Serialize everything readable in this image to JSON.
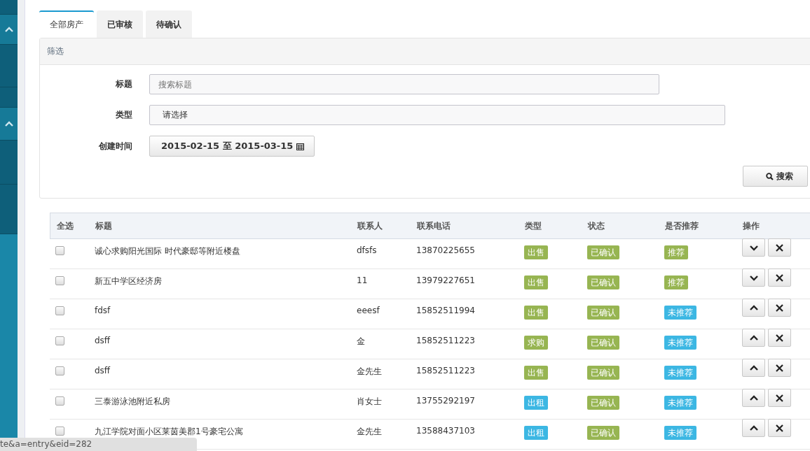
{
  "tabs": [
    {
      "label": "全部房产",
      "selected": true
    },
    {
      "label": "已审核",
      "selected": false
    },
    {
      "label": "待确认",
      "selected": false
    }
  ],
  "filter": {
    "title": "筛选",
    "fields": [
      {
        "kind": "text",
        "label": "标题",
        "placeholder": "搜索标题"
      },
      {
        "kind": "select",
        "label": "类型",
        "value": "请选择"
      },
      {
        "kind": "date",
        "label": "创建时间",
        "value": "2015-02-15 至 2015-03-15"
      }
    ],
    "search_button": "搜索"
  },
  "table": {
    "columns": [
      "全选",
      "标题",
      "联系人",
      "联系电话",
      "类型",
      "状态",
      "是否推荐",
      "操作"
    ],
    "rows": [
      {
        "checked": false,
        "title": "诚心求购阳光国际 时代豪邸等附近楼盘",
        "contact": "dfsfs",
        "phone": "13870225655",
        "type": {
          "label": "出售",
          "color": "#97b552"
        },
        "status": {
          "label": "已确认",
          "color": "#97b552"
        },
        "recommend": {
          "label": "推荐",
          "color": "#97b552"
        },
        "arrow_up": false
      },
      {
        "checked": false,
        "title": "新五中学区经济房",
        "contact": "11",
        "phone": "13979227651",
        "type": {
          "label": "出售",
          "color": "#97b552"
        },
        "status": {
          "label": "已确认",
          "color": "#97b552"
        },
        "recommend": {
          "label": "推荐",
          "color": "#97b552"
        },
        "arrow_up": false
      },
      {
        "checked": false,
        "title": "fdsf",
        "contact": "eeesf",
        "phone": "15852511994",
        "type": {
          "label": "出售",
          "color": "#97b552"
        },
        "status": {
          "label": "已确认",
          "color": "#97b552"
        },
        "recommend": {
          "label": "未推荐",
          "color": "#3cb7e3"
        },
        "arrow_up": true
      },
      {
        "checked": false,
        "title": "dsff",
        "contact": "金",
        "phone": "15852511223",
        "type": {
          "label": "求购",
          "color": "#97b552"
        },
        "status": {
          "label": "已确认",
          "color": "#97b552"
        },
        "recommend": {
          "label": "未推荐",
          "color": "#3cb7e3"
        },
        "arrow_up": true
      },
      {
        "checked": false,
        "title": "dsff",
        "contact": "金先生",
        "phone": "15852511223",
        "type": {
          "label": "出售",
          "color": "#97b552"
        },
        "status": {
          "label": "已确认",
          "color": "#97b552"
        },
        "recommend": {
          "label": "未推荐",
          "color": "#3cb7e3"
        },
        "arrow_up": true
      },
      {
        "checked": false,
        "title": "三泰游泳池附近私房",
        "contact": "肖女士",
        "phone": "13755292197",
        "type": {
          "label": "出租",
          "color": "#3cb7e3"
        },
        "status": {
          "label": "已确认",
          "color": "#97b552"
        },
        "recommend": {
          "label": "未推荐",
          "color": "#3cb7e3"
        },
        "arrow_up": true
      },
      {
        "checked": false,
        "title": "九江学院对面小区莱茵美郡1号豪宅公寓",
        "contact": "金先生",
        "phone": "13588437103",
        "type": {
          "label": "出租",
          "color": "#3cb7e3"
        },
        "status": {
          "label": "已确认",
          "color": "#97b552"
        },
        "recommend": {
          "label": "未推荐",
          "color": "#3cb7e3"
        },
        "arrow_up": true
      }
    ]
  },
  "status_bar": "te&a=entry&eid=282"
}
